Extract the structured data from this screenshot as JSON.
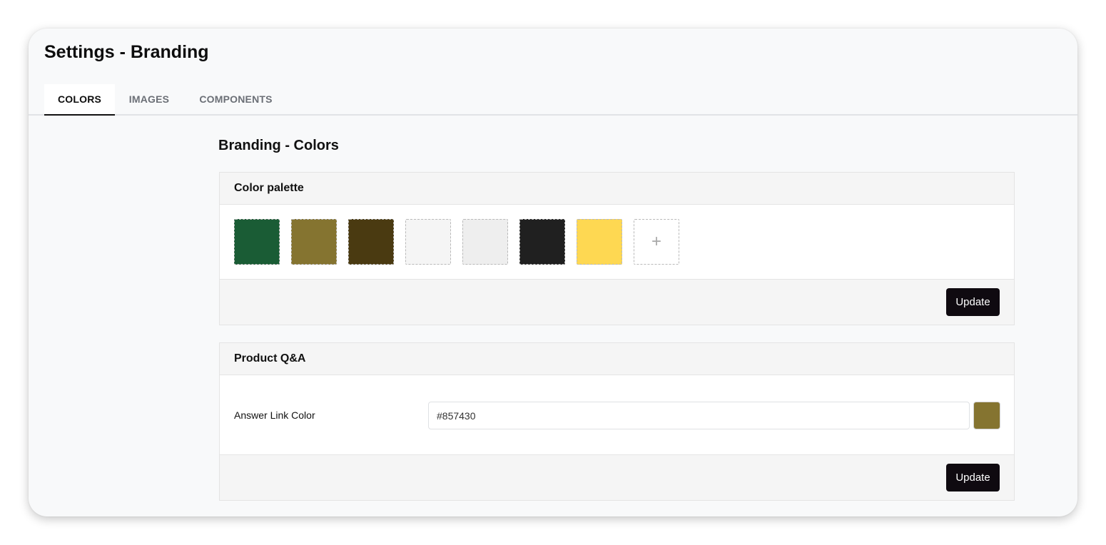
{
  "page": {
    "title": "Settings - Branding"
  },
  "tabs": [
    {
      "label": "COLORS",
      "active": true
    },
    {
      "label": "IMAGES",
      "active": false
    },
    {
      "label": "COMPONENTS",
      "active": false
    }
  ],
  "section": {
    "title": "Branding - Colors"
  },
  "palette": {
    "title": "Color palette",
    "swatches": [
      "#1a5c35",
      "#857430",
      "#4a3a11",
      "#f5f5f5",
      "#eeeeee",
      "#202020",
      "#fed852"
    ],
    "add_label": "+",
    "update_label": "Update"
  },
  "qa": {
    "title": "Product Q&A",
    "answer_link_label": "Answer Link Color",
    "answer_link_value": "#857430",
    "answer_link_swatch": "#857430",
    "update_label": "Update"
  },
  "colors": {
    "button_bg": "#0f0a10",
    "active_tab_underline": "#111111",
    "card_header_bg": "#f5f5f5"
  }
}
